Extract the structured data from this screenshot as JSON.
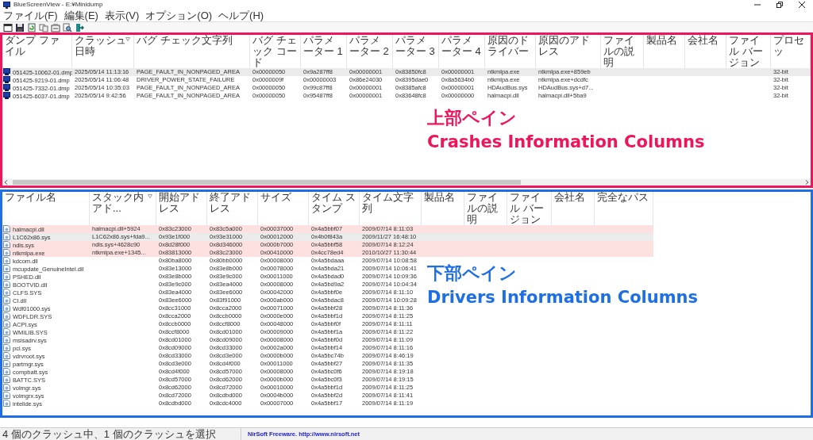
{
  "window": {
    "title": "BlueScreenView  -  E:¥Minidump"
  },
  "menu": [
    "ファイル(F)",
    "編集(E)",
    "表示(V)",
    "オプション(O)",
    "ヘルプ(H)"
  ],
  "crash_table": {
    "columns": [
      {
        "label": "ダンプ ファイル",
        "sorted": false
      },
      {
        "label": "クラッシュ日時",
        "sorted": true
      },
      {
        "label": "バグ チェック文字列",
        "sorted": false
      },
      {
        "label": "バグ チェック コード",
        "sorted": false
      },
      {
        "label": "パラメーター 1",
        "sorted": false
      },
      {
        "label": "パラメーター 2",
        "sorted": false
      },
      {
        "label": "パラメーター 3",
        "sorted": false
      },
      {
        "label": "パラメーター 4",
        "sorted": false
      },
      {
        "label": "原因のドライバー",
        "sorted": false
      },
      {
        "label": "原因のアドレス",
        "sorted": false
      },
      {
        "label": "ファイルの説明",
        "sorted": false
      },
      {
        "label": "製品名",
        "sorted": false
      },
      {
        "label": "会社名",
        "sorted": false
      },
      {
        "label": "ファイル バージョン",
        "sorted": false
      },
      {
        "label": "プロセッ",
        "sorted": false
      }
    ],
    "rows": [
      {
        "selected": true,
        "cells": [
          "051425-10062-01.dmp",
          "2025/05/14 11:13:16",
          "PAGE_FAULT_IN_NONPAGED_AREA",
          "0x00000050",
          "0x9a287ff8",
          "0x00000001",
          "0x83850fc8",
          "0x00000001",
          "ntkmlpa.exe",
          "ntkmlpa.exe+859eb",
          null,
          null,
          null,
          null,
          "32-bit"
        ]
      },
      {
        "selected": false,
        "cells": [
          "051425-9219-01.dmp",
          "2025/05/14 11:06:48",
          "DRIVER_POWER_STATE_FAILURE",
          "0x0000009f",
          "0x00000003",
          "0x86e24030",
          "0x8395dae0",
          "0x8a5634b0",
          "ntkmlpa.exe",
          "ntkmlpa.exe+dcdfc",
          null,
          null,
          null,
          null,
          "32-bit"
        ]
      },
      {
        "selected": false,
        "cells": [
          "051425-7332-01.dmp",
          "2025/05/14 10:35:03",
          "PAGE_FAULT_IN_NONPAGED_AREA",
          "0x00000050",
          "0x99c87ff8",
          "0x00000001",
          "0x8385afc8",
          "0x00000001",
          "HDAudBus.sys",
          "HDAudBus.sys+d7...",
          null,
          null,
          null,
          null,
          "32-bit"
        ]
      },
      {
        "selected": false,
        "cells": [
          "051425-6037-01.dmp",
          "2025/05/14 9:42:56",
          "PAGE_FAULT_IN_NONPAGED_AREA",
          "0x00000050",
          "0x95487ff8",
          "0x00000001",
          "0x83648fc8",
          "0x00000000",
          "halmacpi.dll",
          "halmacpi.dll+5ba9",
          null,
          null,
          null,
          null,
          "32-bit"
        ]
      }
    ]
  },
  "driver_table": {
    "columns": [
      {
        "label": "ファイル名",
        "sorted": false
      },
      {
        "label": "スタック内アド...",
        "sorted": true
      },
      {
        "label": "開始アドレス",
        "sorted": false
      },
      {
        "label": "終了アドレス",
        "sorted": false
      },
      {
        "label": "サイズ",
        "sorted": false
      },
      {
        "label": "タイム スタンプ",
        "sorted": false
      },
      {
        "label": "タイム文字列",
        "sorted": false
      },
      {
        "label": "製品名",
        "sorted": false
      },
      {
        "label": "ファイルの説明",
        "sorted": false
      },
      {
        "label": "ファイル バージョン",
        "sorted": false
      },
      {
        "label": "会社名",
        "sorted": false
      },
      {
        "label": "完全なパス",
        "sorted": false
      }
    ],
    "rows": [
      {
        "selected": false,
        "highlighted": true,
        "cells": [
          "halmacpi.dll",
          "halmacpi.dll+5924",
          "0x83c23000",
          "0x83c5a000",
          "0x00037000",
          "0x4a5bbf07",
          "2009/07/14 8:11:03"
        ]
      },
      {
        "selected": true,
        "highlighted": false,
        "cells": [
          "L1C62x86.sys",
          "L1C62x86.sys+fda9...",
          "0x93e1f000",
          "0x93e31000",
          "0x00012000",
          "0x4b0f843a",
          "2009/11/27 16:48:10"
        ]
      },
      {
        "selected": false,
        "highlighted": true,
        "cells": [
          "ndis.sys",
          "ndis.sys+4628c90",
          "0x8d28f000",
          "0x8d346000",
          "0x000b7000",
          "0x4a5bbf58",
          "2009/07/14 8:12:24"
        ]
      },
      {
        "selected": false,
        "highlighted": true,
        "cells": [
          "ntkmlpa.exe",
          "ntkmlpa.exe+1345...",
          "0x83813000",
          "0x83c23000",
          "0x00410000",
          "0x4cc78ed4",
          "2010/10/27 11:30:44"
        ]
      },
      {
        "selected": false,
        "highlighted": false,
        "cells": [
          "kdcom.dll",
          null,
          "0x80ba8000",
          "0x80bb0000",
          "0x00008000",
          "0x4a5bdaaa",
          "2009/07/14 10:08:58"
        ]
      },
      {
        "selected": false,
        "highlighted": false,
        "cells": [
          "mcupdate_GenuineIntel.dll",
          null,
          "0x83e13000",
          "0x83e8b000",
          "0x00078000",
          "0x4a5bda21",
          "2009/07/14 10:06:41"
        ]
      },
      {
        "selected": false,
        "highlighted": false,
        "cells": [
          "PSHED.dll",
          null,
          "0x83e8b000",
          "0x83e9c000",
          "0x00011000",
          "0x4a5bdad0",
          "2009/07/14 10:09:36"
        ]
      },
      {
        "selected": false,
        "highlighted": false,
        "cells": [
          "BOOTVID.dll",
          null,
          "0x83e9c000",
          "0x83ea4000",
          "0x00008000",
          "0x4a5bd9a2",
          "2009/07/14 10:04:34"
        ]
      },
      {
        "selected": false,
        "highlighted": false,
        "cells": [
          "CLFS.SYS",
          null,
          "0x83ea4000",
          "0x83ee6000",
          "0x00042000",
          "0x4a5bbf0e",
          "2009/07/14 8:11:10"
        ]
      },
      {
        "selected": false,
        "highlighted": false,
        "cells": [
          "CI.dll",
          null,
          "0x83ee6000",
          "0x83f91000",
          "0x000ab000",
          "0x4a5bdac8",
          "2009/07/14 10:09:28"
        ]
      },
      {
        "selected": false,
        "highlighted": false,
        "cells": [
          "Wdf01000.sys",
          null,
          "0x8cc31000",
          "0x8cca2000",
          "0x00071000",
          "0x4a5bbf28",
          "2009/07/14 8:11:36"
        ]
      },
      {
        "selected": false,
        "highlighted": false,
        "cells": [
          "WDFLDR.SYS",
          null,
          "0x8cca2000",
          "0x8ccb0000",
          "0x0000e000",
          "0x4a5bbf1d",
          "2009/07/14 8:11:25"
        ]
      },
      {
        "selected": false,
        "highlighted": false,
        "cells": [
          "ACPI.sys",
          null,
          "0x8ccb0000",
          "0x8ccf8000",
          "0x00048000",
          "0x4a5bbf0f",
          "2009/07/14 8:11:11"
        ]
      },
      {
        "selected": false,
        "highlighted": false,
        "cells": [
          "WMILIB.SYS",
          null,
          "0x8ccf8000",
          "0x8cd01000",
          "0x00009000",
          "0x4a5bbf1a",
          "2009/07/14 8:11:22"
        ]
      },
      {
        "selected": false,
        "highlighted": false,
        "cells": [
          "msisadrv.sys",
          null,
          "0x8cd01000",
          "0x8cd09000",
          "0x00008000",
          "0x4a5bbf0d",
          "2009/07/14 8:11:09"
        ]
      },
      {
        "selected": false,
        "highlighted": false,
        "cells": [
          "pci.sys",
          null,
          "0x8cd09000",
          "0x8cd33000",
          "0x0002a000",
          "0x4a5bbf14",
          "2009/07/14 8:11:16"
        ]
      },
      {
        "selected": false,
        "highlighted": false,
        "cells": [
          "vdrvroot.sys",
          null,
          "0x8cd33000",
          "0x8cd3e000",
          "0x0000b000",
          "0x4a5bc74b",
          "2009/07/14 8:46:19"
        ]
      },
      {
        "selected": false,
        "highlighted": false,
        "cells": [
          "partmgr.sys",
          null,
          "0x8cd3e000",
          "0x8cd4f000",
          "0x00011000",
          "0x4a5bbf27",
          "2009/07/14 8:11:35"
        ]
      },
      {
        "selected": false,
        "highlighted": false,
        "cells": [
          "compbatt.sys",
          null,
          "0x8cd4f000",
          "0x8cd57000",
          "0x00008000",
          "0x4a5bc0f6",
          "2009/07/14 8:19:18"
        ]
      },
      {
        "selected": false,
        "highlighted": false,
        "cells": [
          "BATTC.SYS",
          null,
          "0x8cd57000",
          "0x8cd62000",
          "0x0000b000",
          "0x4a5bc0f3",
          "2009/07/14 8:19:15"
        ]
      },
      {
        "selected": false,
        "highlighted": false,
        "cells": [
          "volmgr.sys",
          null,
          "0x8cd62000",
          "0x8cd72000",
          "0x00010000",
          "0x4a5bbf1d",
          "2009/07/14 8:11:25"
        ]
      },
      {
        "selected": false,
        "highlighted": false,
        "cells": [
          "volmgrx.sys",
          null,
          "0x8cd72000",
          "0x8cdbd000",
          "0x0004b000",
          "0x4a5bbf2d",
          "2009/07/14 8:11:41"
        ]
      },
      {
        "selected": false,
        "highlighted": false,
        "cells": [
          "intelide.sys",
          null,
          "0x8cdbd000",
          "0x8cdc4000",
          "0x00007000",
          "0x4a5bbf17",
          "2009/07/14 8:11:19"
        ]
      }
    ]
  },
  "annotations": [
    {
      "heading": "上部ペイン",
      "caption": "Crashes Information Columns",
      "color": "#f0145a"
    },
    {
      "heading": "下部ペイン",
      "caption": "Drivers Information Columns",
      "color": "#1e6ee6"
    }
  ],
  "status_bar": {
    "selection": "4 個のクラッシュ中、1 個のクラッシュを選択",
    "link": "NirSoft Freeware.  http://www.nirsoft.net"
  }
}
